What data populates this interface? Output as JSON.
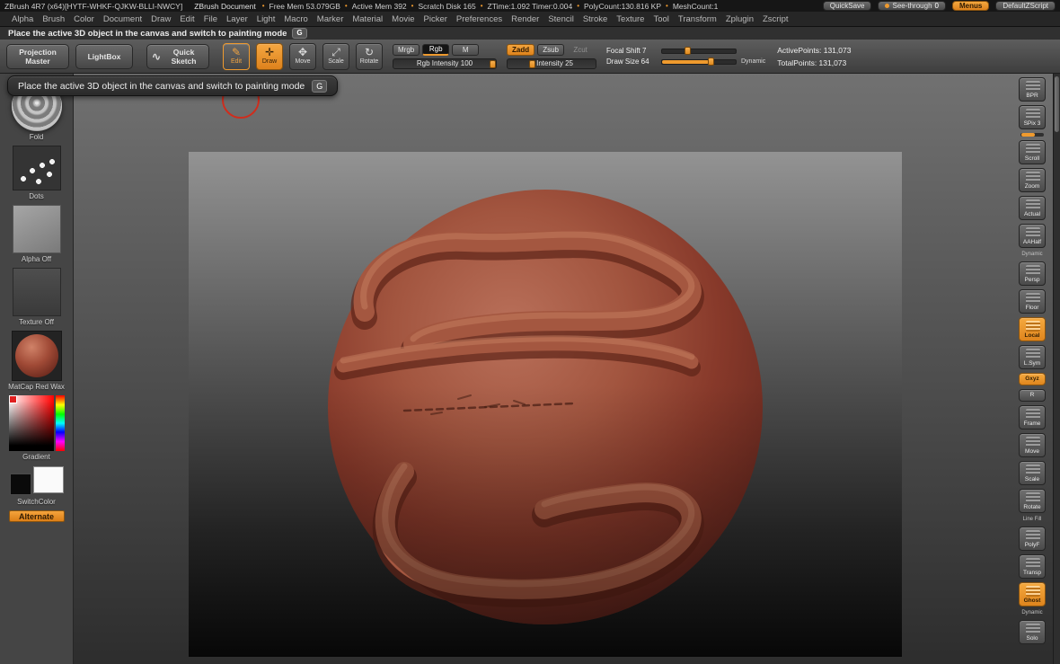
{
  "colors": {
    "accent": "#ef9a2e",
    "material_red": "#9c4a38",
    "cursor_ring": "#cf2d1d"
  },
  "title_bar": {
    "app_title": "ZBrush 4R7 (x64)[HYTF-WHKF-QJKW-BLLI-NWCY]",
    "doc_title": "ZBrush Document",
    "stats": [
      "Free Mem 53.079GB",
      "Active Mem 392",
      "Scratch Disk 165",
      "ZTime:1.092 Timer:0.004",
      "PolyCount:130.816 KP",
      "MeshCount:1"
    ],
    "quicksave_label": "QuickSave",
    "see_through_label": "See-through",
    "see_through_value": "0",
    "menus_label": "Menus",
    "zscript_label": "DefaultZScript"
  },
  "menu_bar": {
    "items": [
      "Alpha",
      "Brush",
      "Color",
      "Document",
      "Draw",
      "Edit",
      "File",
      "Layer",
      "Light",
      "Macro",
      "Marker",
      "Material",
      "Movie",
      "Picker",
      "Preferences",
      "Render",
      "Stencil",
      "Stroke",
      "Texture",
      "Tool",
      "Transform",
      "Zplugin",
      "Zscript"
    ]
  },
  "hint_bar": {
    "text": "Place the active 3D object in the canvas and switch to painting mode",
    "shortcut": "G"
  },
  "tooltip": {
    "text": "Place the active 3D object in the canvas and switch to painting mode",
    "shortcut": "G"
  },
  "toolbar": {
    "projection_master": "Projection Master",
    "lightbox": "LightBox",
    "quick_sketch": "Quick Sketch",
    "edit": "Edit",
    "draw": "Draw",
    "move": "Move",
    "scale": "Scale",
    "rotate": "Rotate",
    "mrgb": "Mrgb",
    "rgb": "Rgb",
    "m": "M",
    "rgb_intensity": "Rgb Intensity 100",
    "zadd": "Zadd",
    "zsub": "Zsub",
    "zcut": "Zcut",
    "z_intensity": "Z Intensity 25",
    "focal_shift_label": "Focal Shift 7",
    "draw_size_label": "Draw Size 64",
    "dynamic_label": "Dynamic",
    "active_points": "ActivePoints: 131,073",
    "total_points": "TotalPoints: 131,073"
  },
  "left_panel": {
    "brush_label": "Fold",
    "stroke_label": "Dots",
    "alpha_label": "Alpha Off",
    "texture_label": "Texture Off",
    "material_label": "MatCap Red Wax",
    "gradient_label": "Gradient",
    "switch_color_label": "SwitchColor",
    "alternate_label": "Alternate"
  },
  "right_panel": {
    "items": [
      {
        "label": "BPR"
      },
      {
        "label": "SPix 3",
        "slider": true
      },
      {
        "label": "Scroll"
      },
      {
        "label": "Zoom"
      },
      {
        "label": "Actual"
      },
      {
        "label": "AAHalf"
      },
      {
        "label": "Persp",
        "section": "Dynamic"
      },
      {
        "label": "Floor"
      },
      {
        "label": "Local",
        "accent": true
      },
      {
        "label": "L.Sym"
      },
      {
        "label": "Gxyz",
        "accent": true,
        "small": true
      },
      {
        "label": "R",
        "small": true
      },
      {
        "label": "Frame"
      },
      {
        "label": "Move"
      },
      {
        "label": "Scale"
      },
      {
        "label": "Rotate"
      },
      {
        "label": "PolyF",
        "section": "Line Fill"
      },
      {
        "label": "Transp"
      },
      {
        "label": "Ghost",
        "accent": true
      },
      {
        "label": "Solo",
        "section": "Dynamic"
      }
    ]
  }
}
